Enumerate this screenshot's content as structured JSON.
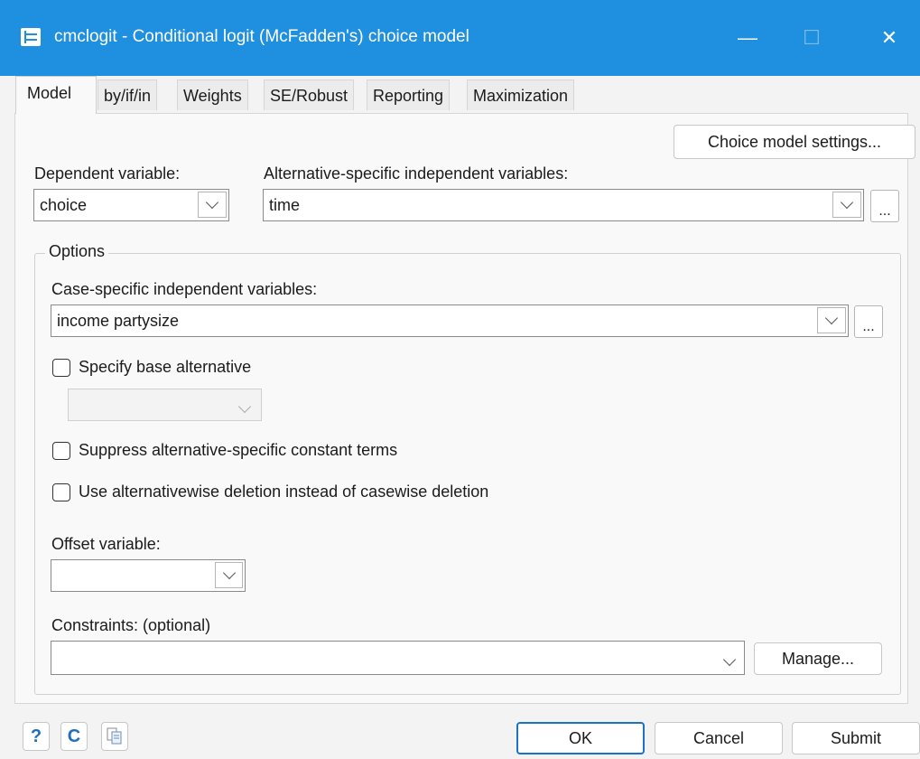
{
  "window": {
    "title": "cmclogit - Conditional logit (McFadden's) choice model",
    "controls": {
      "minimize": "—",
      "maximize": "☐",
      "close": "✕"
    },
    "accent_color": "#1f8fdf"
  },
  "tabs": [
    {
      "label": "Model",
      "active": true
    },
    {
      "label": "by/if/in"
    },
    {
      "label": "Weights"
    },
    {
      "label": "SE/Robust"
    },
    {
      "label": "Reporting"
    },
    {
      "label": "Maximization"
    }
  ],
  "choice_model_settings_label": "Choice model settings...",
  "dependent_variable": {
    "label": "Dependent variable:",
    "value": "choice"
  },
  "alt_specific": {
    "label": "Alternative-specific independent variables:",
    "value": "time",
    "ellipsis": "..."
  },
  "options": {
    "title": "Options",
    "case_specific": {
      "label": "Case-specific independent variables:",
      "value": "income partysize",
      "ellipsis": "..."
    },
    "base_alternative": {
      "label": "Specify base alternative",
      "checked": false,
      "value": ""
    },
    "suppress_constant": {
      "label": "Suppress alternative-specific constant terms",
      "checked": false
    },
    "alternativewise": {
      "label": "Use alternativewise deletion instead of casewise deletion",
      "checked": false
    },
    "offset": {
      "label": "Offset variable:",
      "value": ""
    },
    "constraints": {
      "label": "Constraints: (optional)",
      "value": "",
      "manage_label": "Manage..."
    }
  },
  "footer": {
    "help_icon": "?",
    "reset_icon": "C",
    "copy_icon": "copy-icon",
    "ok": "OK",
    "cancel": "Cancel",
    "submit": "Submit"
  }
}
